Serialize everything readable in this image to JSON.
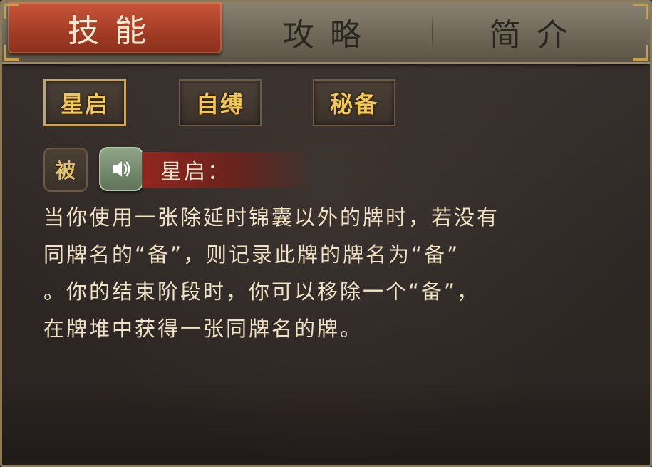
{
  "tabs": [
    {
      "label": "技能",
      "active": true
    },
    {
      "label": "攻略",
      "active": false
    },
    {
      "label": "简介",
      "active": false
    }
  ],
  "skills": [
    {
      "label": "星启",
      "selected": true
    },
    {
      "label": "自缚",
      "selected": false
    },
    {
      "label": "秘备",
      "selected": false
    }
  ],
  "detail": {
    "type_badge": "被",
    "voice_icon": "speaker-icon",
    "title": "星启：",
    "description_lines": [
      "当你使用一张除延时锦囊以外的牌时，若没有",
      "同牌名的“备”，则记录此牌的牌名为“备”",
      "。你的结束阶段时，你可以移除一个“备”，",
      "在牌堆中获得一张同牌名的牌。"
    ]
  },
  "colors": {
    "active_tab": "#a63d26",
    "tab_bar": "#6f6757",
    "skill_text": "#f0c858",
    "body_text": "#efe2c6",
    "voice_button": "#6f8868"
  }
}
